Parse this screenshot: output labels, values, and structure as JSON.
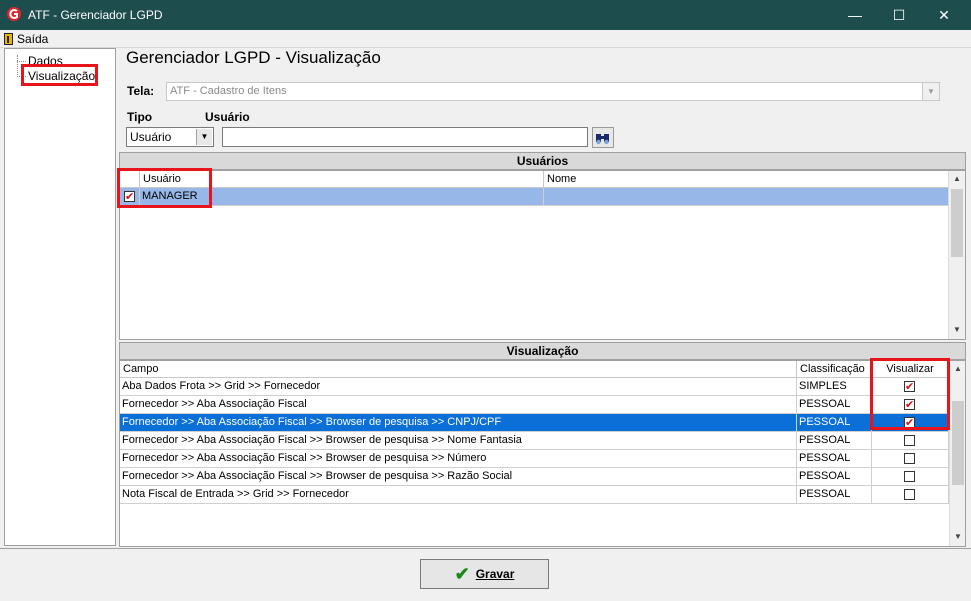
{
  "window": {
    "title": "ATF - Gerenciador LGPD",
    "minimize": "—",
    "maximize": "☐",
    "close": "✕"
  },
  "menu": {
    "exit_label": "Saída"
  },
  "sidebar": {
    "items": [
      {
        "label": "Dados"
      },
      {
        "label": "Visualização"
      }
    ]
  },
  "page": {
    "title": "Gerenciador LGPD - Visualização"
  },
  "filters": {
    "tela_label": "Tela:",
    "tela_value": "ATF - Cadastro de Itens",
    "tipo_label": "Tipo",
    "tipo_value": "Usuário",
    "usuario_label": "Usuário",
    "usuario_value": ""
  },
  "usuarios": {
    "title": "Usuários",
    "columns": [
      "Usuário",
      "Nome"
    ],
    "rows": [
      {
        "checked": true,
        "usuario": "MANAGER",
        "nome": ""
      }
    ]
  },
  "visualizacao": {
    "title": "Visualização",
    "columns": [
      "Campo",
      "Classificação",
      "Visualizar"
    ],
    "rows": [
      {
        "campo": "Aba Dados Frota >> Grid >> Fornecedor",
        "classificacao": "SIMPLES",
        "visualizar": true
      },
      {
        "campo": "Fornecedor >> Aba Associação Fiscal",
        "classificacao": "PESSOAL",
        "visualizar": true
      },
      {
        "campo": "Fornecedor >> Aba Associação Fiscal >> Browser de pesquisa >> CNPJ/CPF",
        "classificacao": "PESSOAL",
        "visualizar": true
      },
      {
        "campo": "Fornecedor >> Aba Associação Fiscal >> Browser de pesquisa >> Nome Fantasia",
        "classificacao": "PESSOAL",
        "visualizar": false
      },
      {
        "campo": "Fornecedor >> Aba Associação Fiscal >> Browser de pesquisa >> Número",
        "classificacao": "PESSOAL",
        "visualizar": false
      },
      {
        "campo": "Fornecedor >> Aba Associação Fiscal >> Browser de pesquisa >> Razão Social",
        "classificacao": "PESSOAL",
        "visualizar": false
      },
      {
        "campo": "Nota Fiscal de Entrada >> Grid >> Fornecedor",
        "classificacao": "PESSOAL",
        "visualizar": false
      }
    ]
  },
  "footer": {
    "gravar_label": "Gravar"
  },
  "colors": {
    "titlebar": "#1e4d4d",
    "selection_blue": "#0a6fd6",
    "selection_light": "#97b7e9",
    "highlight_red": "#e8141b"
  }
}
